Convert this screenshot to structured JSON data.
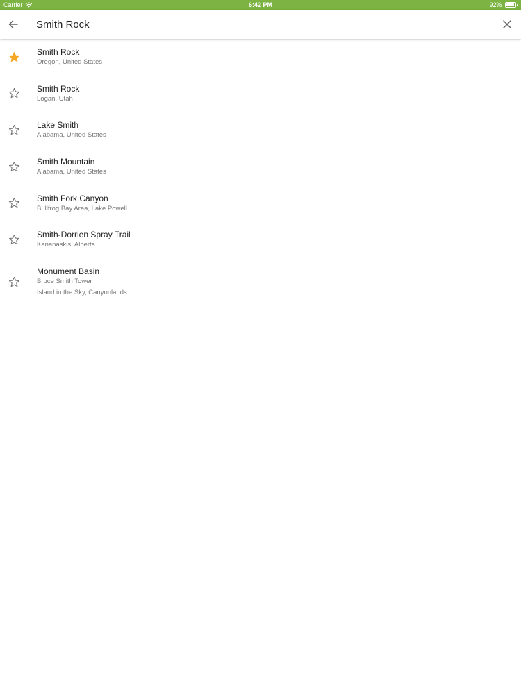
{
  "status_bar": {
    "carrier": "Carrier",
    "time": "6:42 PM",
    "battery_text": "92%",
    "battery_level": 0.92,
    "background_color": "#7cb342"
  },
  "search": {
    "query": "Smith Rock",
    "back_icon": "arrow-left-icon",
    "clear_icon": "close-icon"
  },
  "colors": {
    "star_active": "#f5a623",
    "star_inactive": "#757575"
  },
  "results": [
    {
      "title": "Smith Rock",
      "subtitle": "Oregon, United States",
      "favorited": true
    },
    {
      "title": "Smith Rock",
      "subtitle": "Logan, Utah",
      "favorited": false
    },
    {
      "title": "Lake Smith",
      "subtitle": "Alabama, United States",
      "favorited": false
    },
    {
      "title": "Smith Mountain",
      "subtitle": "Alabama, United States",
      "favorited": false
    },
    {
      "title": "Smith Fork Canyon",
      "subtitle": "Bullfrog Bay Area, Lake Powell",
      "favorited": false
    },
    {
      "title": "Smith-Dorrien Spray Trail",
      "subtitle": "Kananaskis, Alberta",
      "favorited": false
    },
    {
      "title": "Monument Basin",
      "subtitle": "Bruce Smith Tower",
      "subtitle2": "Island in the Sky, Canyonlands",
      "favorited": false
    }
  ]
}
